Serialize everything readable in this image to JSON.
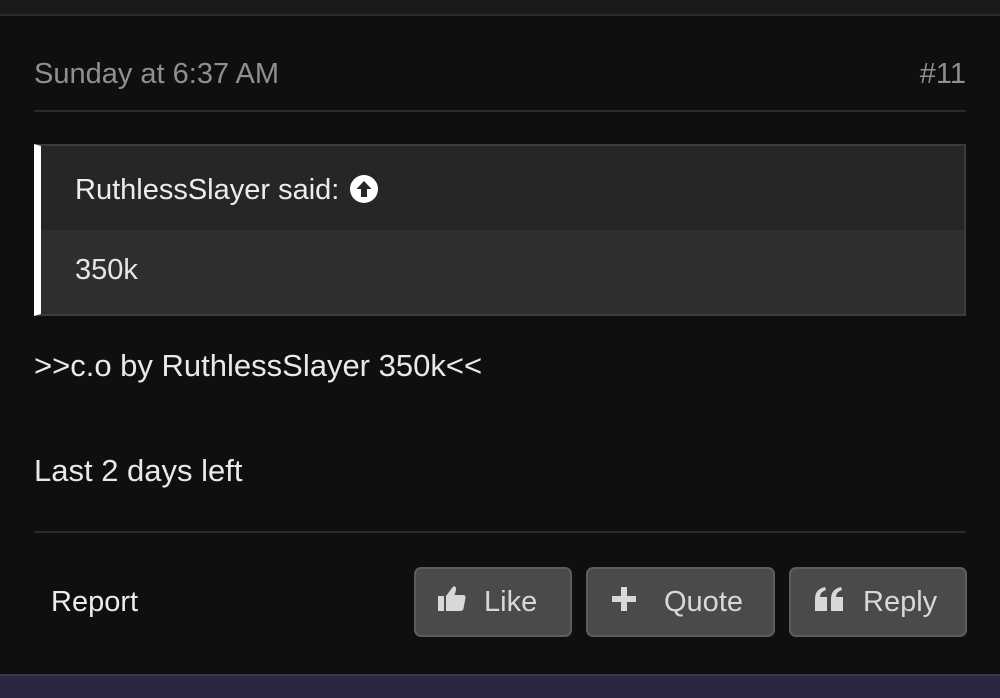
{
  "post": {
    "date": "Sunday at 6:37 AM",
    "number": "#11",
    "quote": {
      "attribution": "RuthlessSlayer said:",
      "jump_icon": "arrow-circle-up-icon",
      "body": "350k"
    },
    "message": {
      "line1": ">>c.o by RuthlessSlayer 350k<<",
      "line2": "Last 2 days left"
    },
    "actions": {
      "report_label": "Report",
      "like_label": "Like",
      "like_icon": "thumbs-up-icon",
      "quote_label": "Quote",
      "quote_icon": "plus-icon",
      "reply_label": "Reply",
      "reply_icon": "quote-marks-icon"
    }
  },
  "colors": {
    "background": "#0f0f0f",
    "quote_bg": "#2e2e2e",
    "quote_head_bg": "#262626",
    "quote_accent": "#ffffff",
    "button_bg": "#4a4a4a",
    "muted_text": "#8f8f8f",
    "text": "#e9e9e9"
  }
}
